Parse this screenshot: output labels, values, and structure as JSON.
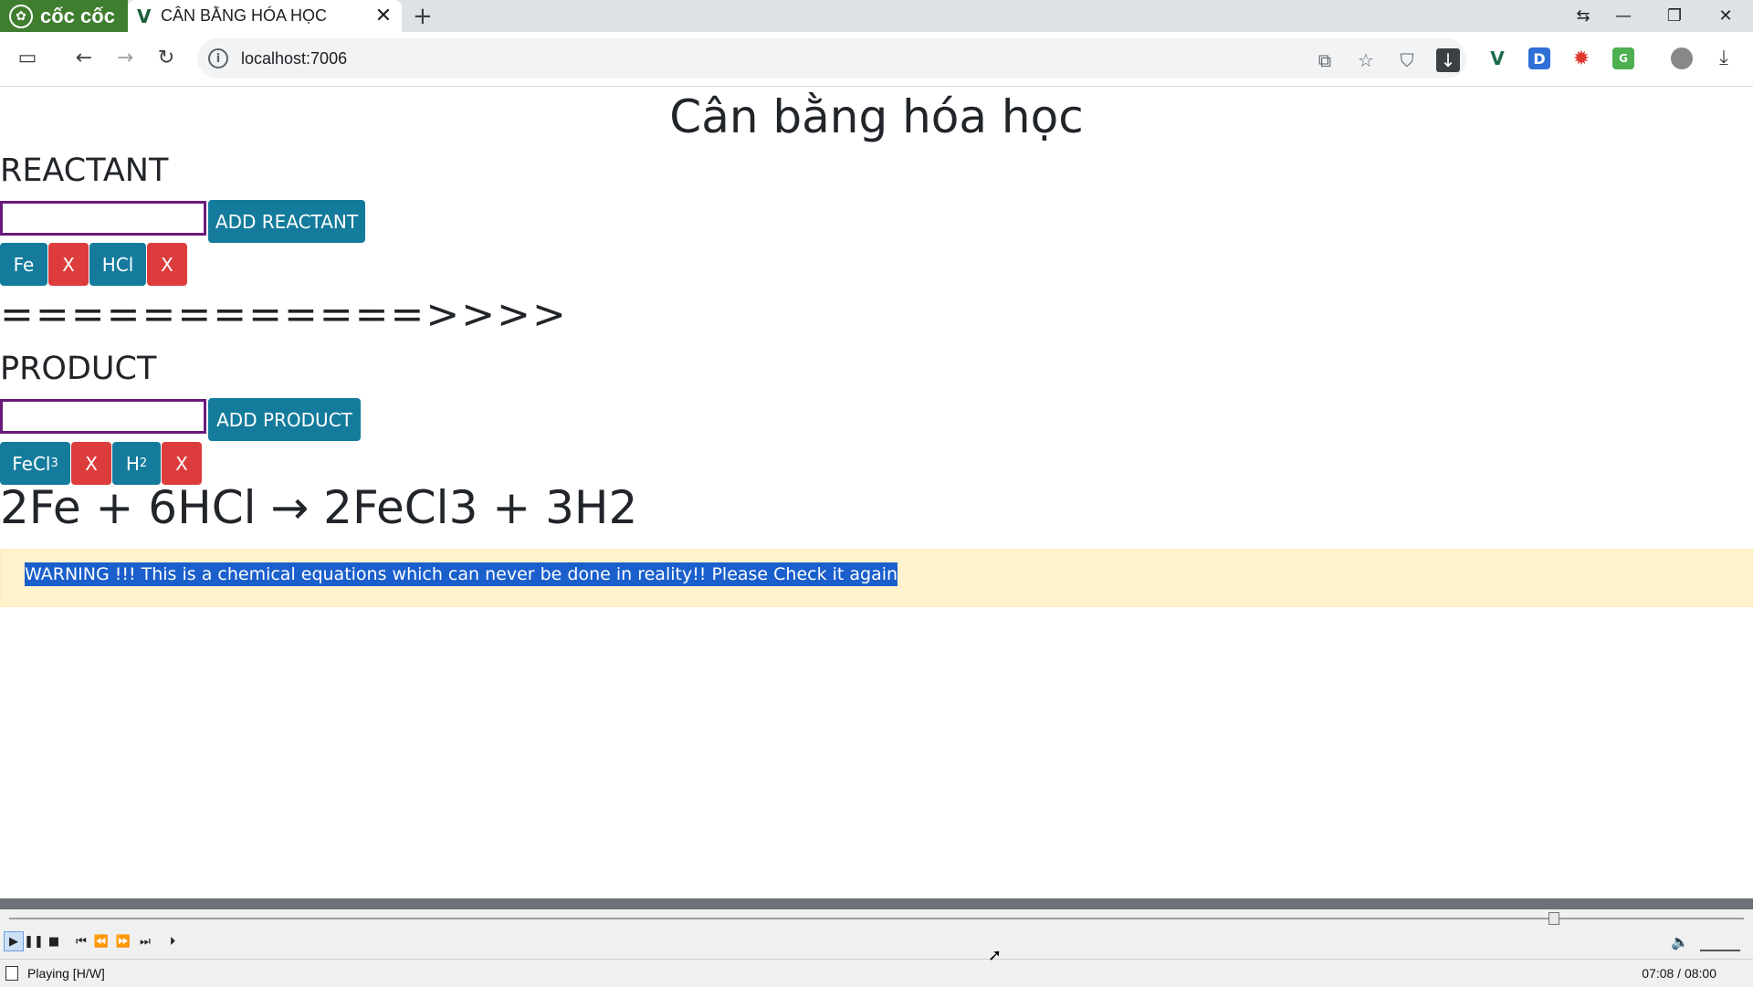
{
  "browser": {
    "brand": "cốc cốc",
    "tab": {
      "title": "CÂN BẰNG HÓA HỌC",
      "favicon": "vue-icon"
    },
    "url": "localhost:7006"
  },
  "page": {
    "title": "Cân bằng hóa học",
    "reactant": {
      "heading": "REACTANT",
      "input_value": "",
      "add_label": "ADD REACTANT",
      "items": [
        {
          "formula": "Fe",
          "sub": "",
          "remove": "X"
        },
        {
          "formula": "HCl",
          "sub": "",
          "remove": "X"
        }
      ]
    },
    "arrow": "============>>>>",
    "product": {
      "heading": "PRODUCT",
      "input_value": "",
      "add_label": "ADD PRODUCT",
      "items": [
        {
          "formula": "FeCl",
          "sub": "3",
          "remove": "X"
        },
        {
          "formula": "H",
          "sub": "2",
          "remove": "X"
        }
      ]
    },
    "equation": "2Fe + 6HCl → 2FeCl3 + 3H2",
    "warning": "WARNING !!! This is a chemical equations which can never be done in reality!! Please Check it again"
  },
  "player": {
    "state": "Playing [H/W]",
    "time": "07:08 / 08:00",
    "progress_fraction": 0.89
  },
  "colors": {
    "teal_button": "#147b9c",
    "red_button": "#dc3c3c",
    "warning_bg": "#fff3cd",
    "input_border": "#6a1b7a"
  }
}
